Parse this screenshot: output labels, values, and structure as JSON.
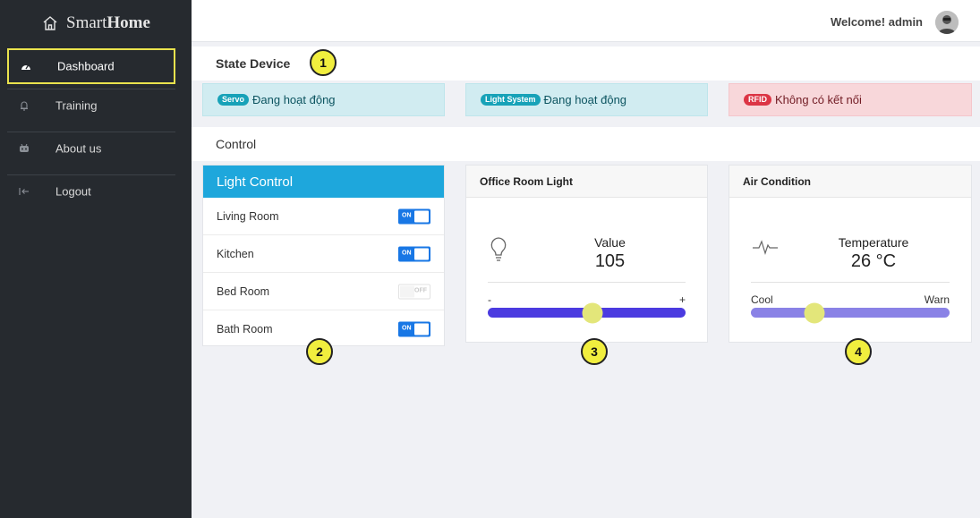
{
  "sidebar": {
    "brand_prefix": "Smart",
    "brand_bold": "Home",
    "items": [
      {
        "label": "Dashboard",
        "icon": "dashboard-icon",
        "active": true
      },
      {
        "label": "Training",
        "icon": "bell-icon",
        "active": false
      },
      {
        "label": "About us",
        "icon": "robot-icon",
        "active": false
      },
      {
        "label": "Logout",
        "icon": "logout-icon",
        "active": false
      }
    ]
  },
  "header": {
    "welcome": "Welcome! admin",
    "avatar": "user-avatar"
  },
  "state_device": {
    "title": "State Device",
    "alerts": [
      {
        "badge": "Servo",
        "text": "Đang hoạt động",
        "status": "info"
      },
      {
        "badge": "Light System",
        "text": "Đang hoạt động",
        "status": "info"
      },
      {
        "badge": "RFID",
        "text": "Không có kết nối",
        "status": "danger"
      }
    ]
  },
  "control": {
    "title": "Control",
    "light_control": {
      "title": "Light Control",
      "rooms": [
        {
          "name": "Living Room",
          "state": "ON",
          "on": true
        },
        {
          "name": "Kitchen",
          "state": "ON",
          "on": true
        },
        {
          "name": "Bed Room",
          "state": "OFF",
          "on": false
        },
        {
          "name": "Bath Room",
          "state": "ON",
          "on": true
        }
      ]
    },
    "office_light": {
      "title": "Office Room Light",
      "label": "Value",
      "value": "105",
      "min_label": "-",
      "max_label": "+",
      "slider_level": 0.53,
      "color": "#4b3be0"
    },
    "air_condition": {
      "title": "Air Condition",
      "label": "Temperature",
      "value": "26 °C",
      "min_label": "Cool",
      "max_label": "Warn",
      "slider_level": 0.32,
      "color": "#8a82e6"
    }
  },
  "callouts": [
    "1",
    "2",
    "3",
    "4"
  ],
  "colors": {
    "sidebar_bg": "#262a2f",
    "active_outline": "#e9e24d",
    "card_header_blue": "#1ea7dc",
    "toggle_blue": "#1877e5",
    "slider_thumb": "#e3e67a",
    "callout_fill": "#f1ee3e"
  }
}
